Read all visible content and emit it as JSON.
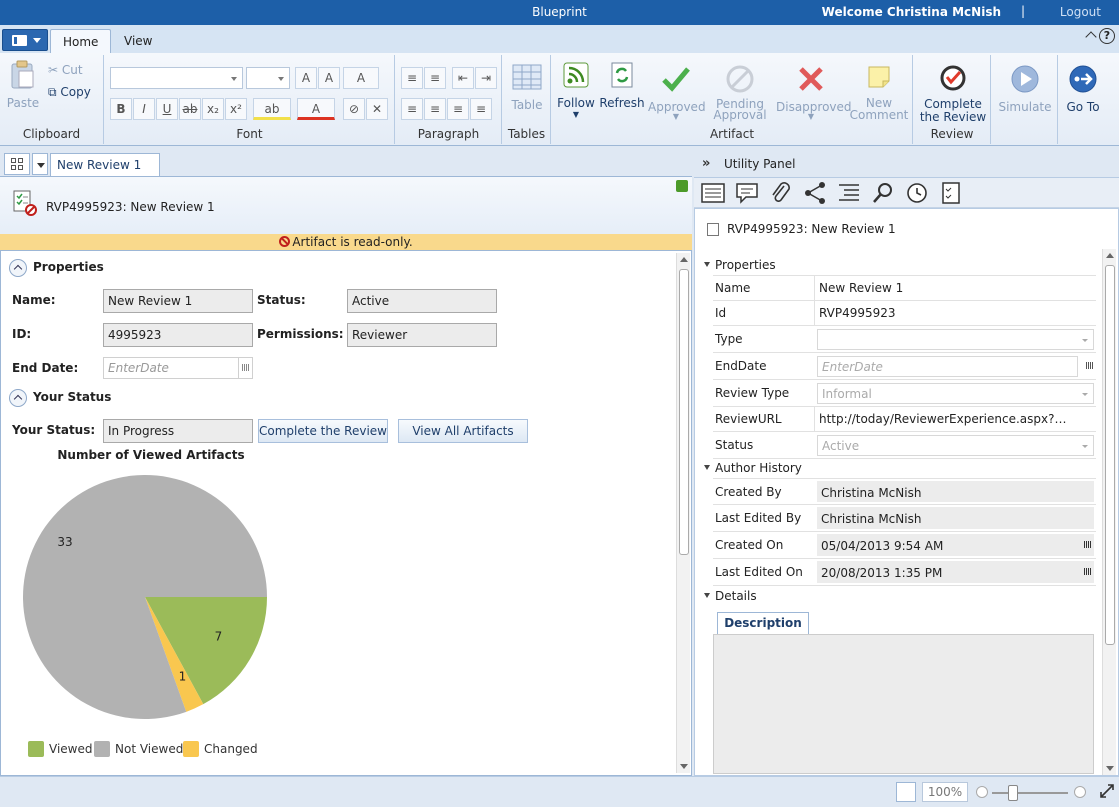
{
  "window": {
    "app_title": "Blueprint",
    "welcome": "Welcome Christina McNish",
    "separator": "|",
    "logout": "Logout"
  },
  "ribbon_tabs": [
    "Home",
    "View"
  ],
  "ribbon": {
    "clipboard": {
      "label": "Clipboard",
      "paste": "Paste",
      "cut": "Cut",
      "copy": "Copy"
    },
    "font": {
      "label": "Font"
    },
    "paragraph": {
      "label": "Paragraph"
    },
    "tables": {
      "label": "Tables",
      "table": "Table"
    },
    "artifact": {
      "label": "Artifact",
      "follow": "Follow",
      "refresh": "Refresh",
      "approved": "Approved",
      "pending_approval": "Pending Approval",
      "disapproved": "Disapproved",
      "new_comment": "New Comment"
    },
    "review": {
      "label": "Review",
      "complete": "Complete the Review"
    },
    "simulate": "Simulate",
    "goto": "Go To"
  },
  "document": {
    "tab_label": "New Review 1",
    "title": "RVP4995923: New Review 1",
    "readonly_notice": "Artifact is read-only.",
    "properties_section": "Properties",
    "fields": {
      "name_label": "Name:",
      "name_value": "New Review 1",
      "status_label": "Status:",
      "status_value": "Active",
      "id_label": "ID:",
      "id_value": "4995923",
      "permissions_label": "Permissions:",
      "permissions_value": "Reviewer",
      "enddate_label": "End Date:",
      "enddate_placeholder": "EnterDate"
    },
    "your_status_section": "Your Status",
    "your_status_label": "Your Status:",
    "your_status_value": "In Progress",
    "complete_button": "Complete the Review",
    "view_all_button": "View All Artifacts"
  },
  "chart_data": {
    "type": "pie",
    "title": "Number of Viewed Artifacts",
    "slices": [
      {
        "label": "Not Viewed",
        "value": 33,
        "color": "#b2b2b2"
      },
      {
        "label": "Viewed",
        "value": 7,
        "color": "#9bbb59"
      },
      {
        "label": "Changed",
        "value": 1,
        "color": "#f9c74f"
      }
    ],
    "legend": [
      "Viewed",
      "Not Viewed",
      "Changed"
    ],
    "legend_colors": [
      "#9bbb59",
      "#b2b2b2",
      "#f9c74f"
    ],
    "legend_position": "bottom"
  },
  "utility_panel": {
    "title": "Utility Panel",
    "collapse_glyph": "»",
    "artifact_title": "RVP4995923: New Review 1",
    "properties_group": "Properties",
    "properties": {
      "name_label": "Name",
      "name_value": "New Review 1",
      "id_label": "Id",
      "id_value": "RVP4995923",
      "type_label": "Type",
      "enddate_label": "EndDate",
      "enddate_placeholder": "EnterDate",
      "review_type_label": "Review Type",
      "review_type_value": "Informal",
      "reviewurl_label": "ReviewURL",
      "reviewurl_value": "http://today/ReviewerExperience.aspx?…",
      "status_label": "Status",
      "status_value": "Active"
    },
    "author_group": "Author History",
    "author": {
      "created_by_label": "Created By",
      "created_by_value": "Christina McNish",
      "last_edited_by_label": "Last Edited By",
      "last_edited_by_value": "Christina McNish",
      "created_on_label": "Created On",
      "created_on_value": "05/04/2013 9:54 AM",
      "last_edited_on_label": "Last Edited On",
      "last_edited_on_value": "20/08/2013 1:35 PM"
    },
    "details_group": "Details",
    "description_tab": "Description"
  },
  "statusbar": {
    "zoom": "100%"
  }
}
